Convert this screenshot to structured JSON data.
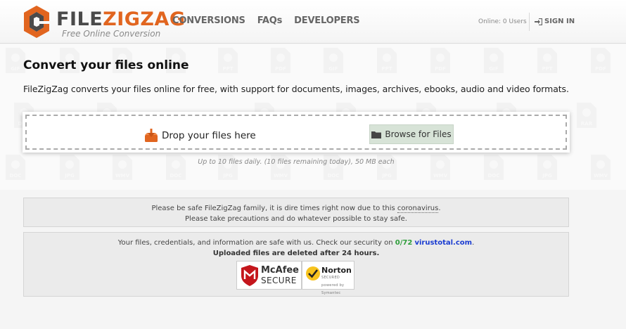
{
  "brand": {
    "name_part1": "FILE",
    "name_part2": "ZIGZAG",
    "tagline": "Free Online Conversion",
    "accent_color": "#e1651f"
  },
  "nav": {
    "items": [
      {
        "label": "CONVERSIONS"
      },
      {
        "label": "FAQs"
      },
      {
        "label": "DEVELOPERS"
      }
    ]
  },
  "header": {
    "online_status": "Online: 0 Users",
    "signin_label": "SIGN IN",
    "signin_icon": "sign-in-icon"
  },
  "hero": {
    "title": "Convert your files online",
    "description": "FileZigZag converts your files online for free, with support for documents, images, archives, ebooks, audio and video formats.",
    "background_icon_labels": [
      "GIF",
      "PPT",
      "PDF",
      "GIF",
      "PPT",
      "PDF",
      "GIF",
      "PPT",
      "PDF",
      "RAR",
      "DOC",
      "JPG",
      "WMV",
      "DOC",
      "JPG",
      "WMV",
      "DOC",
      "JPG",
      "WMV"
    ]
  },
  "upload": {
    "drop_label": "Drop your files here",
    "drop_icon": "download-box-icon",
    "browse_label": "Browse for Files",
    "browse_icon": "folder-icon",
    "limits": "Up to 10 files daily. (10 files remaining today), 50 MB each"
  },
  "notice_covid": {
    "line1_before": "Please be safe FileZigZag family, it is dire times right now due to this ",
    "line1_link": "coronavirus",
    "line1_after": ".",
    "line2": "Please take precautions and do whatever possible to stay safe."
  },
  "notice_security": {
    "line1_before": "Your files, credentials, and information are safe with us. Check our security on ",
    "score": "0/72",
    "site": "virustotal.com",
    "line1_after": ".",
    "line2": "Uploaded files are deleted after 24 hours.",
    "mcafee_name": "McAfee",
    "mcafee_secure": "SECURE",
    "norton_name": "Norton",
    "norton_secured": "SECURED",
    "norton_powered": "powered by Symantec"
  }
}
